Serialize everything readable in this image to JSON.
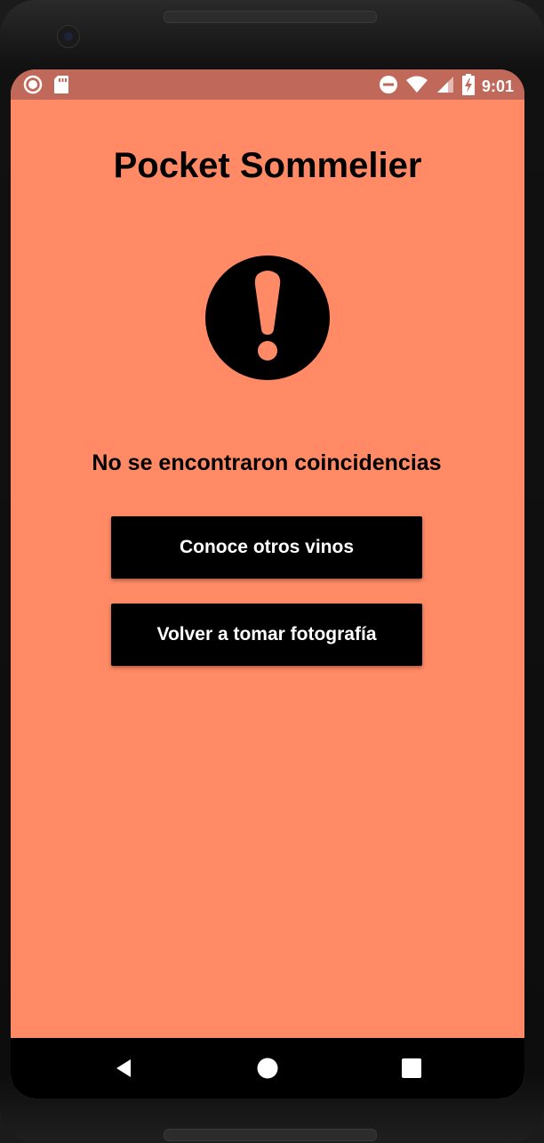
{
  "status_bar": {
    "time": "9:01",
    "left_icons": [
      "record-icon",
      "sd-card-icon"
    ],
    "right_icons": [
      "do-not-disturb-icon",
      "wifi-icon",
      "signal-icon",
      "battery-charging-icon"
    ],
    "color": "#c0695a"
  },
  "app": {
    "title": "Pocket Sommelier",
    "alert_icon": "exclamation-circle-icon",
    "message": "No se encontraron coincidencias",
    "buttons": {
      "explore_label": "Conoce otros vinos",
      "retake_label": "Volver a tomar fotografía"
    },
    "background_color": "#ff8a65",
    "button_color": "#000000"
  },
  "nav_bar": {
    "icons": [
      "back-icon",
      "home-icon",
      "recents-icon"
    ]
  }
}
